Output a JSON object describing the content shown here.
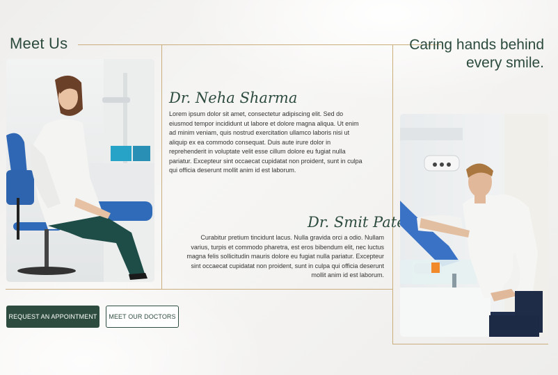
{
  "header": {
    "title": "Meet Us",
    "tagline": "Caring hands behind every smile."
  },
  "doctors": [
    {
      "name": "Dr. Neha Sharma",
      "bio": "Lorem ipsum dolor sit amet, consectetur adipiscing elit. Sed do eiusmod tempor incididunt ut labore et dolore magna aliqua. Ut enim ad minim veniam, quis nostrud exercitation ullamco laboris nisi ut aliquip ex ea commodo consequat. Duis aute irure dolor in reprehenderit in voluptate velit esse cillum dolore eu fugiat nulla pariatur. Excepteur sint occaecat cupidatat non proident, sunt in culpa qui officia deserunt mollit anim id est laborum."
    },
    {
      "name": "Dr. Smit Patel",
      "bio": "Curabitur pretium tincidunt lacus. Nulla gravida orci a odio. Nullam varius, turpis et commodo pharetra, est eros bibendum elit, nec luctus magna felis sollicitudin mauris dolore eu fugiat nulla pariatur. Excepteur sint occaecat cupidatat non proident, sunt in culpa qui officia deserunt mollit anim id est laborum."
    }
  ],
  "actions": {
    "request_label": "REQUEST AN APPOINTMENT",
    "meet_label": "MEET OUR DOCTORS"
  },
  "colors": {
    "brand_green": "#2d4c3f",
    "rule_gold": "#c9ad7a",
    "background": "#f4f3f1"
  }
}
